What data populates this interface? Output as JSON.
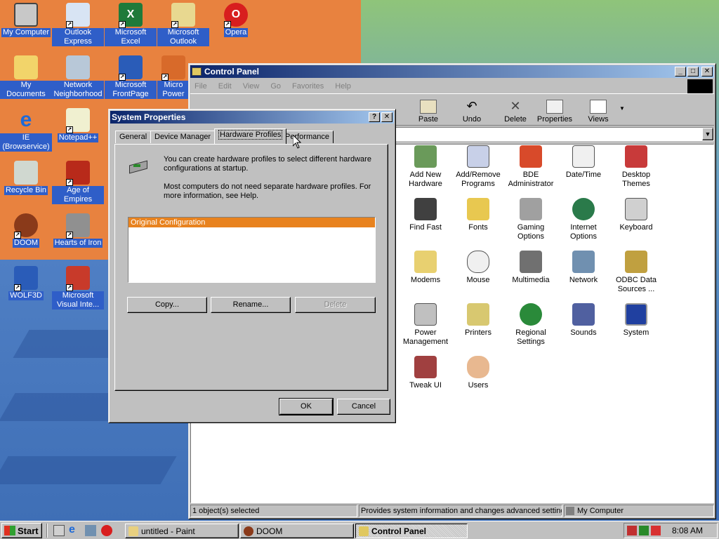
{
  "desktop": {
    "icons": [
      {
        "label": "My Computer"
      },
      {
        "label": "Outlook Express"
      },
      {
        "label": "Microsoft Excel"
      },
      {
        "label": "Microsoft Outlook"
      },
      {
        "label": "Opera"
      },
      {
        "label": "My Documents"
      },
      {
        "label": "Network Neighborhood"
      },
      {
        "label": "Microsoft FrontPage"
      },
      {
        "label": "Micro Power"
      },
      {
        "label": "IE (Browservice)"
      },
      {
        "label": "Notepad++"
      },
      {
        "label": "Recycle Bin"
      },
      {
        "label": "Age of Empires"
      },
      {
        "label": "DOOM"
      },
      {
        "label": "Hearts of Iron"
      },
      {
        "label": "WOLF3D"
      },
      {
        "label": "Microsoft Visual Inte..."
      }
    ]
  },
  "control_panel": {
    "title": "Control Panel",
    "menu": [
      "File",
      "Edit",
      "View",
      "Go",
      "Favorites",
      "Help"
    ],
    "toolbar": [
      "Paste",
      "Undo",
      "Delete",
      "Properties",
      "Views"
    ],
    "items": [
      "Add New Hardware",
      "Add/Remove Programs",
      "BDE Administrator",
      "Date/Time",
      "Desktop Themes",
      "Find Fast",
      "Fonts",
      "Gaming Options",
      "Internet Options",
      "Keyboard",
      "Modems",
      "Mouse",
      "Multimedia",
      "Network",
      "ODBC Data Sources ...",
      "Power Management",
      "Printers",
      "Regional Settings",
      "Sounds",
      "System",
      "Tweak UI",
      "Users"
    ],
    "status": {
      "selected": "1 object(s) selected",
      "description": "Provides system information and changes advanced setting",
      "location": "My Computer"
    }
  },
  "system_properties": {
    "title": "System Properties",
    "help_button": "?",
    "close_button": "✕",
    "tabs": [
      "General",
      "Device Manager",
      "Hardware Profiles",
      "Performance"
    ],
    "info_1": "You can create hardware profiles to select different hardware configurations at startup.",
    "info_2": "Most computers do not need separate hardware profiles. For more information, see Help.",
    "profiles": [
      "Original Configuration"
    ],
    "buttons": {
      "copy": "Copy...",
      "rename": "Rename...",
      "delete": "Delete",
      "ok": "OK",
      "cancel": "Cancel"
    }
  },
  "taskbar": {
    "start": "Start",
    "tasks": [
      "untitled - Paint",
      "DOOM",
      "Control Panel"
    ],
    "clock": "8:08 AM"
  }
}
